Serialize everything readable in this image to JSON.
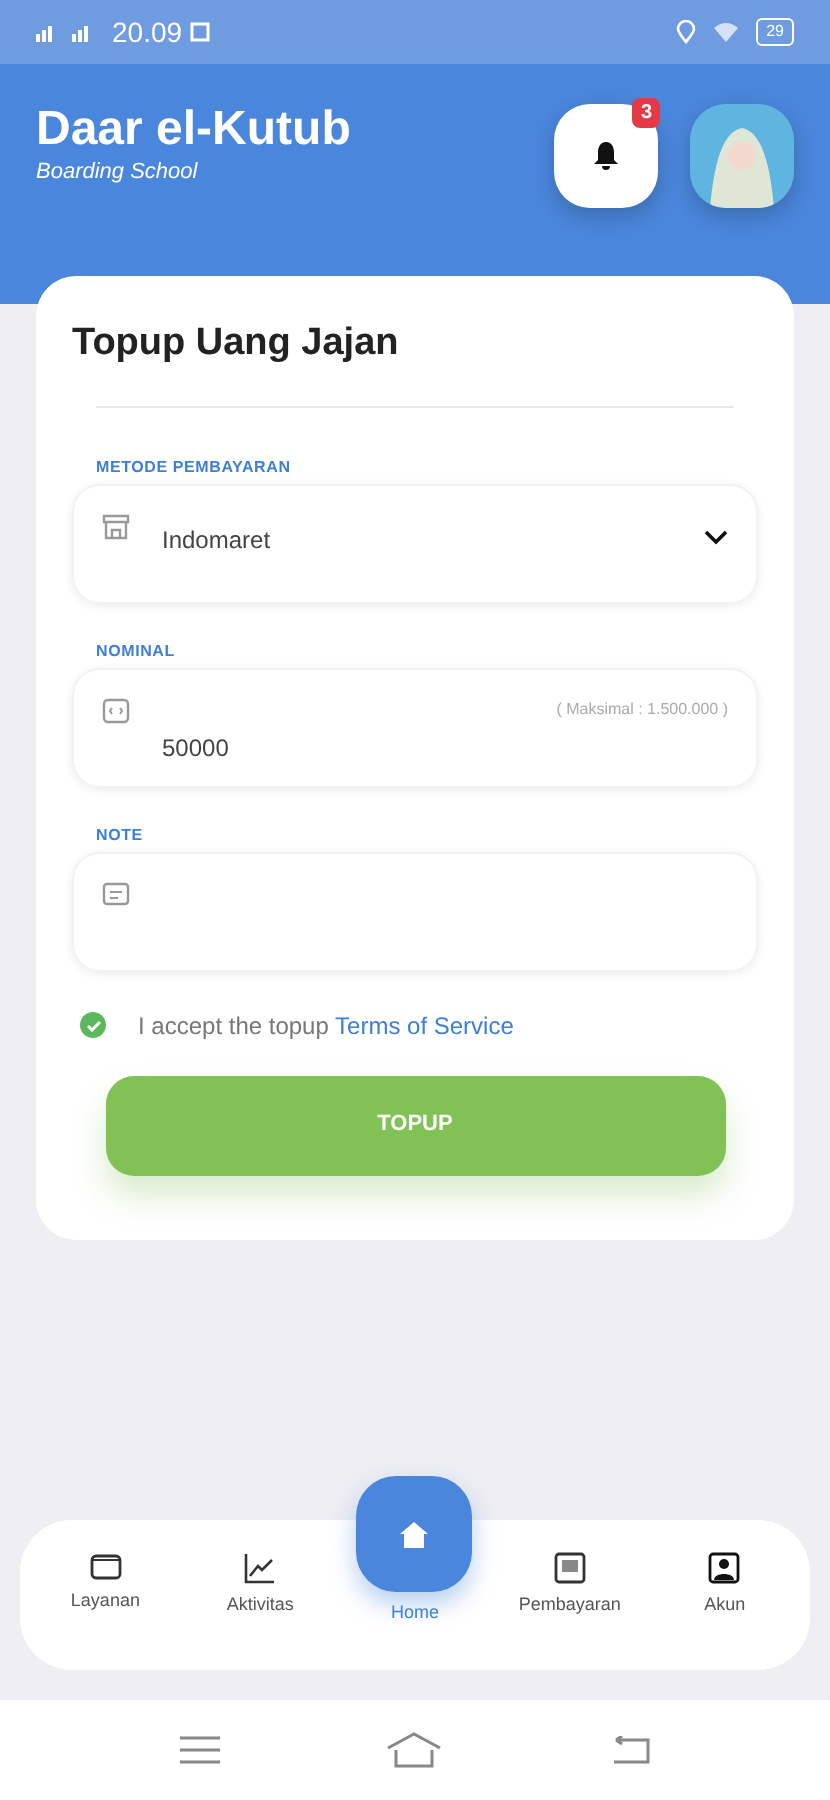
{
  "status_bar": {
    "time": "20.09",
    "battery": "29"
  },
  "header": {
    "title": "Daar el-Kutub",
    "subtitle": "Boarding School",
    "notification_count": "3"
  },
  "form": {
    "title": "Topup Uang Jajan",
    "fields": [
      {
        "kind": "select",
        "label": "METODE PEMBAYARAN",
        "value": "Indomaret"
      },
      {
        "kind": "number",
        "label": "NOMINAL",
        "value": "50000",
        "hint": "( Maksimal : 1.500.000 )"
      },
      {
        "kind": "note",
        "label": "NOTE"
      }
    ],
    "terms": {
      "checked": true,
      "text": "I accept the topup",
      "link": "Terms of Service"
    },
    "submit": "TOPUP"
  },
  "bottom_nav": [
    {
      "label": "Layanan",
      "selected": false
    },
    {
      "label": "Aktivitas",
      "selected": false
    },
    {
      "label": "Home",
      "selected": true
    },
    {
      "label": "Pembayaran",
      "selected": false
    },
    {
      "label": "Akun",
      "selected": false
    }
  ]
}
